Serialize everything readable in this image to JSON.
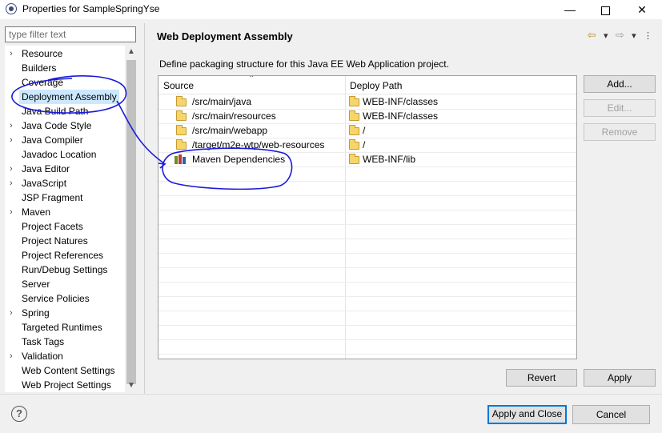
{
  "window": {
    "title": "Properties for SampleSpringYse",
    "minimize_glyph": "—",
    "close_glyph": "✕"
  },
  "filter": {
    "placeholder": "type filter text"
  },
  "tree": {
    "items": [
      {
        "label": "Resource",
        "expandable": true,
        "arrow": "›"
      },
      {
        "label": "Builders",
        "expandable": false,
        "arrow": ""
      },
      {
        "label": "Coverage",
        "expandable": false,
        "arrow": ""
      },
      {
        "label": "Deployment Assembly",
        "expandable": false,
        "arrow": "",
        "selected": true
      },
      {
        "label": "Java Build Path",
        "expandable": false,
        "arrow": ""
      },
      {
        "label": "Java Code Style",
        "expandable": true,
        "arrow": "›"
      },
      {
        "label": "Java Compiler",
        "expandable": true,
        "arrow": "›"
      },
      {
        "label": "Javadoc Location",
        "expandable": false,
        "arrow": ""
      },
      {
        "label": "Java Editor",
        "expandable": true,
        "arrow": "›"
      },
      {
        "label": "JavaScript",
        "expandable": true,
        "arrow": "›"
      },
      {
        "label": "JSP Fragment",
        "expandable": false,
        "arrow": ""
      },
      {
        "label": "Maven",
        "expandable": true,
        "arrow": "›"
      },
      {
        "label": "Project Facets",
        "expandable": false,
        "arrow": ""
      },
      {
        "label": "Project Natures",
        "expandable": false,
        "arrow": ""
      },
      {
        "label": "Project References",
        "expandable": false,
        "arrow": ""
      },
      {
        "label": "Run/Debug Settings",
        "expandable": false,
        "arrow": ""
      },
      {
        "label": "Server",
        "expandable": false,
        "arrow": ""
      },
      {
        "label": "Service Policies",
        "expandable": false,
        "arrow": ""
      },
      {
        "label": "Spring",
        "expandable": true,
        "arrow": "›"
      },
      {
        "label": "Targeted Runtimes",
        "expandable": false,
        "arrow": ""
      },
      {
        "label": "Task Tags",
        "expandable": false,
        "arrow": ""
      },
      {
        "label": "Validation",
        "expandable": true,
        "arrow": "›"
      },
      {
        "label": "Web Content Settings",
        "expandable": false,
        "arrow": ""
      },
      {
        "label": "Web Project Settings",
        "expandable": false,
        "arrow": ""
      }
    ]
  },
  "page": {
    "title": "Web Deployment Assembly",
    "description": "Define packaging structure for this Java EE Web Application project."
  },
  "table": {
    "columns": {
      "source": "Source",
      "deploy": "Deploy Path"
    },
    "rows": [
      {
        "source": "/src/main/java",
        "deploy": "WEB-INF/classes",
        "icon": "folder-icon"
      },
      {
        "source": "/src/main/resources",
        "deploy": "WEB-INF/classes",
        "icon": "folder-icon"
      },
      {
        "source": "/src/main/webapp",
        "deploy": "/",
        "icon": "folder-icon"
      },
      {
        "source": "/target/m2e-wtp/web-resources",
        "deploy": "/",
        "icon": "folder-icon"
      },
      {
        "source": "Maven Dependencies",
        "deploy": "WEB-INF/lib",
        "icon": "library-icon"
      }
    ]
  },
  "buttons": {
    "add": "Add...",
    "edit": "Edit...",
    "remove": "Remove",
    "revert": "Revert",
    "apply": "Apply",
    "apply_close": "Apply and Close",
    "cancel": "Cancel"
  },
  "colors": {
    "selection": "#cce8ff",
    "annotation": "#1a1adb",
    "primary_border": "#0078d7"
  }
}
